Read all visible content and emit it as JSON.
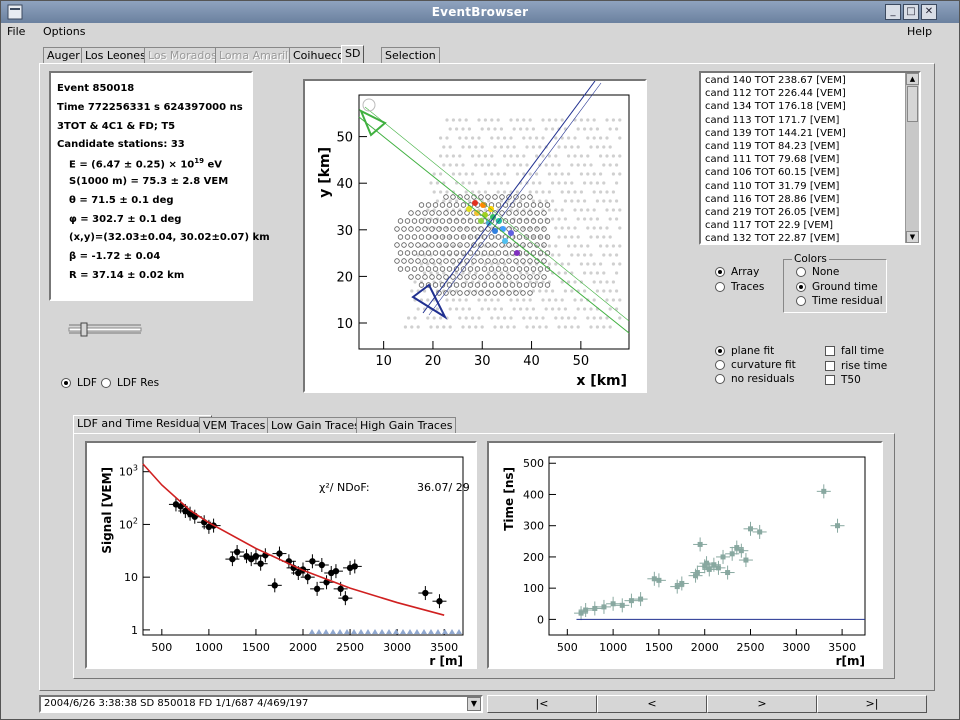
{
  "window": {
    "title": "EventBrowser"
  },
  "menu": {
    "file": "File",
    "options": "Options",
    "help": "Help"
  },
  "tabs": [
    {
      "label": "Auger",
      "state": "normal"
    },
    {
      "label": "Los Leones",
      "state": "normal"
    },
    {
      "label": "Los Morados",
      "state": "disabled"
    },
    {
      "label": "Loma Amarilla",
      "state": "disabled"
    },
    {
      "label": "Coihueco",
      "state": "normal"
    },
    {
      "label": "SD",
      "state": "active"
    },
    {
      "label": "Selection",
      "state": "normal"
    }
  ],
  "event_info": {
    "event": "Event 850018",
    "time": "Time 772256331 s 624397000 ns",
    "trigger": "3TOT & 4C1 & FD; T5",
    "candidate": "Candidate stations:  33",
    "energy_prefix": "E = (6.47 ± 0.25) × 10",
    "energy_exp": "19",
    "energy_unit": " eV",
    "s1000": "S(1000 m) =   75.3 ±  2.8 VEM",
    "theta": "θ =  71.5 ±  0.1 deg",
    "phi": "φ = 302.7 ±  0.1 deg",
    "xy": "(x,y)=(32.03±0.04, 30.02±0.07) km",
    "beta": "β = -1.72 ± 0.04",
    "r": "R  = 37.14 ±  0.02 km"
  },
  "ldf_radio": {
    "ldf": "LDF",
    "ldf_res": "LDF Res",
    "selected": "ldf"
  },
  "array_plot": {
    "xlabel": "x [km]",
    "ylabel": "y [km]",
    "xticks": [
      "10",
      "20",
      "30",
      "40",
      "50"
    ],
    "yticks": [
      "10",
      "20",
      "30",
      "40",
      "50"
    ]
  },
  "station_list": [
    "cand 140 TOT   238.67 [VEM]",
    "cand 112 TOT   226.44 [VEM]",
    "cand 134 TOT   176.18 [VEM]",
    "cand 113 TOT     171.7 [VEM]",
    "cand 139 TOT   144.21 [VEM]",
    "cand 119 TOT     84.23 [VEM]",
    "cand 111 TOT     79.68 [VEM]",
    "cand 106 TOT     60.15 [VEM]",
    "cand 110 TOT     31.79 [VEM]",
    "cand 116 TOT     28.86 [VEM]",
    "cand 219 TOT     26.05 [VEM]",
    "cand 117 TOT       22.9 [VEM]",
    "cand 132 TOT     22.87 [VEM]"
  ],
  "view_radio": {
    "array": "Array",
    "traces": "Traces",
    "selected": "array"
  },
  "colors": {
    "legend": "Colors",
    "none": "None",
    "ground_time": "Ground time",
    "time_residual": "Time residual",
    "selected": "ground_time"
  },
  "fit_radio": {
    "plane": "plane fit",
    "curvature": "curvature fit",
    "noresid": "no residuals",
    "selected": "plane"
  },
  "checks": {
    "fall": "fall time",
    "rise": "rise time",
    "t50": "T50"
  },
  "bottom_tabs": [
    "LDF and Time Residuals",
    "VEM Traces",
    "Low Gain Traces",
    "High Gain Traces"
  ],
  "status": {
    "text": "2004/6/26 3:38:38  SD 850018 FD 1/1/687 4/469/197"
  },
  "nav": {
    "first": "|<",
    "prev": "<",
    "next": ">",
    "last": ">|"
  },
  "chart_data": [
    {
      "type": "scatter",
      "title": "",
      "xlabel": "r [m]",
      "ylabel": "Signal [VEM]",
      "annotation_label": "χ²/ NDoF:",
      "annotation_value": "36.07/ 29",
      "xlim": [
        300,
        3700
      ],
      "ylim": [
        0.8,
        1900
      ],
      "yscale": "log",
      "xticks": [
        500,
        1000,
        1500,
        2000,
        2500,
        3000,
        3500
      ],
      "yticks": [
        {
          "v": 1,
          "label": "1"
        },
        {
          "v": 10,
          "label": "10"
        },
        {
          "v": 100,
          "label": "10",
          "exp": "2"
        },
        {
          "v": 1000,
          "label": "10",
          "exp": "3"
        }
      ],
      "series": [
        {
          "kind": "points",
          "x": [
            650,
            700,
            750,
            800,
            850,
            950,
            1000,
            1050,
            1250,
            1300,
            1400,
            1450,
            1500,
            1550,
            1600,
            1700,
            1750,
            1850,
            1900,
            1950,
            2000,
            2050,
            2100,
            2150,
            2200,
            2250,
            2300,
            2350,
            2400,
            2450,
            2500,
            2550,
            3300,
            3450
          ],
          "y": [
            240,
            220,
            180,
            160,
            140,
            110,
            90,
            95,
            22,
            30,
            25,
            22,
            25,
            18,
            26,
            7,
            28,
            20,
            15,
            12,
            14,
            10,
            20,
            6,
            17,
            8,
            12,
            13,
            6,
            4,
            15,
            16,
            5,
            3.5
          ]
        },
        {
          "kind": "fit",
          "x": [
            300,
            500,
            800,
            1000,
            1500,
            2000,
            2500,
            3000,
            3500
          ],
          "y": [
            1400,
            560,
            185,
            108,
            35,
            13.5,
            6.2,
            3.3,
            1.9
          ]
        }
      ]
    },
    {
      "type": "scatter",
      "title": "",
      "xlabel": "r[m]",
      "ylabel": "Time [ns]",
      "xlim": [
        300,
        3750
      ],
      "ylim": [
        -50,
        520
      ],
      "xticks": [
        500,
        1000,
        1500,
        2000,
        2500,
        3000,
        3500
      ],
      "yticks": [
        0,
        100,
        200,
        300,
        400,
        500
      ],
      "series": [
        {
          "kind": "points",
          "x": [
            650,
            700,
            800,
            900,
            1000,
            1100,
            1200,
            1300,
            1450,
            1500,
            1700,
            1750,
            1900,
            1920,
            1950,
            2000,
            2020,
            2050,
            2100,
            2150,
            2200,
            2250,
            2300,
            2350,
            2400,
            2450,
            2500,
            2600,
            3300,
            3450
          ],
          "y": [
            20,
            30,
            35,
            40,
            50,
            45,
            60,
            65,
            130,
            125,
            105,
            115,
            140,
            150,
            240,
            170,
            180,
            160,
            175,
            165,
            200,
            150,
            210,
            230,
            220,
            190,
            290,
            280,
            410,
            300
          ]
        },
        {
          "kind": "baseline",
          "x": [
            600,
            3750
          ],
          "y": [
            0,
            0
          ]
        }
      ]
    }
  ]
}
